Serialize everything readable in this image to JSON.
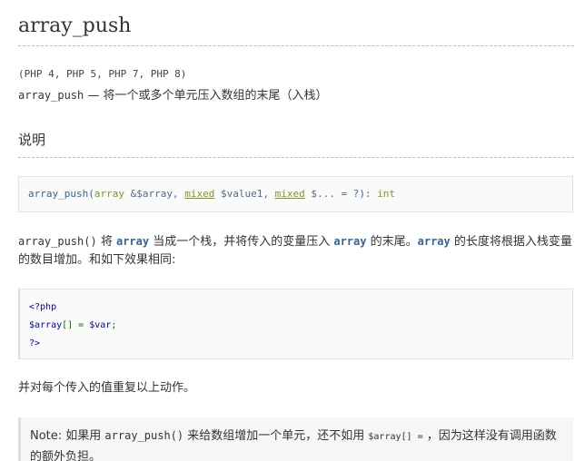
{
  "doc": {
    "title": "array_push",
    "versions": "(PHP 4, PHP 5, PHP 7, PHP 8)",
    "refpurpose": {
      "name": "array_push",
      "dash": " — ",
      "description": "将一个或多个单元压入数组的末尾（入栈）"
    },
    "section_title": "说明",
    "methodsynopsis": {
      "function": "array_push",
      "open": "(",
      "type1": "array",
      "param1": " &$array",
      "comma1": ", ",
      "type2": "mixed",
      "param2": " $value1",
      "comma2": ", ",
      "type3": "mixed",
      "param3": " $... = ?",
      "close": "): ",
      "return_type": "int"
    },
    "paragraph1": {
      "fn": "array_push()",
      "t1": " 将 ",
      "kw1": "array",
      "t2": " 当成一个栈，并将传入的变量压入 ",
      "kw2": "array",
      "t3": " 的末尾。",
      "kw3": "array",
      "t4": " 的长度将根据入栈变量的数目增加。和如下效果相同:"
    },
    "code": {
      "line1": "<?php",
      "line2_var": "$array",
      "line2_op": "[] = ",
      "line2_val": "$var",
      "line2_end": ";",
      "line3": "?>"
    },
    "paragraph2": "并对每个传入的值重复以上动作。",
    "note": {
      "label": "Note: 如果用 ",
      "fn": "array_push()",
      "t1": " 来给数组增加一个单元，还不如用 ",
      "code": "$array[] =",
      "t2": " ，因为这样没有调用函数的额外负担。"
    }
  }
}
